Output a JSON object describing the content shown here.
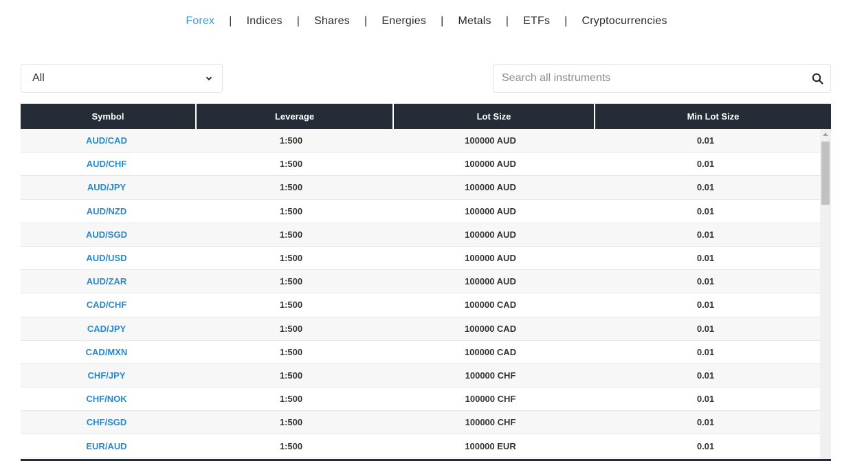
{
  "nav": {
    "categories": [
      "Forex",
      "Indices",
      "Shares",
      "Energies",
      "Metals",
      "ETFs",
      "Cryptocurrencies"
    ],
    "active": "Forex",
    "active_color": "#3a9ad9",
    "separator": "|"
  },
  "filter": {
    "selected": "All"
  },
  "search": {
    "placeholder": "Search all instruments",
    "value": ""
  },
  "table": {
    "header_bg": "#262c36",
    "symbol_color": "#2a88cc",
    "columns": [
      "Symbol",
      "Leverage",
      "Lot Size",
      "Min Lot Size"
    ],
    "rows": [
      [
        "AUD/CAD",
        "1:500",
        "100000 AUD",
        "0.01"
      ],
      [
        "AUD/CHF",
        "1:500",
        "100000 AUD",
        "0.01"
      ],
      [
        "AUD/JPY",
        "1:500",
        "100000 AUD",
        "0.01"
      ],
      [
        "AUD/NZD",
        "1:500",
        "100000 AUD",
        "0.01"
      ],
      [
        "AUD/SGD",
        "1:500",
        "100000 AUD",
        "0.01"
      ],
      [
        "AUD/USD",
        "1:500",
        "100000 AUD",
        "0.01"
      ],
      [
        "AUD/ZAR",
        "1:500",
        "100000 AUD",
        "0.01"
      ],
      [
        "CAD/CHF",
        "1:500",
        "100000 CAD",
        "0.01"
      ],
      [
        "CAD/JPY",
        "1:500",
        "100000 CAD",
        "0.01"
      ],
      [
        "CAD/MXN",
        "1:500",
        "100000 CAD",
        "0.01"
      ],
      [
        "CHF/JPY",
        "1:500",
        "100000 CHF",
        "0.01"
      ],
      [
        "CHF/NOK",
        "1:500",
        "100000 CHF",
        "0.01"
      ],
      [
        "CHF/SGD",
        "1:500",
        "100000 CHF",
        "0.01"
      ],
      [
        "EUR/AUD",
        "1:500",
        "100000 EUR",
        "0.01"
      ]
    ]
  }
}
